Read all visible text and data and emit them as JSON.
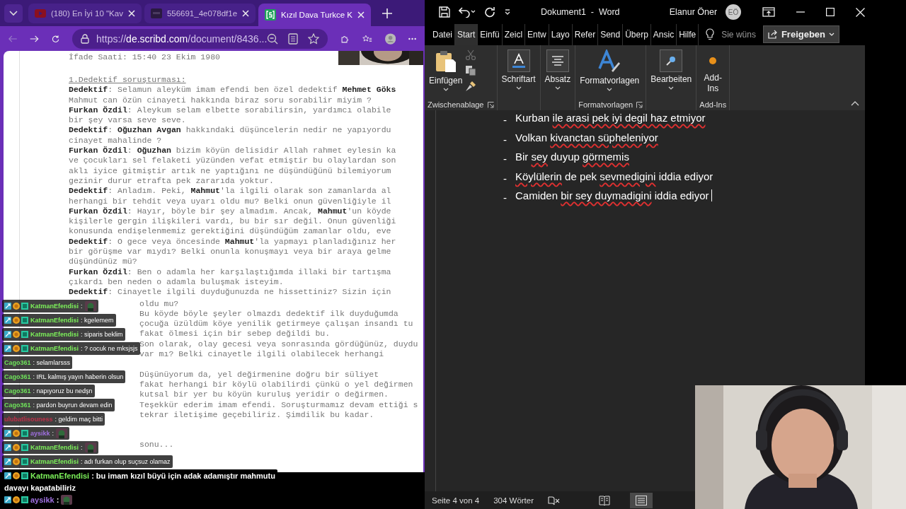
{
  "browser": {
    "tabs": [
      {
        "title": "(180) En İyi 10 \"Kav",
        "kind": "video",
        "selected": false
      },
      {
        "title": "556691_4e078df1e",
        "kind": "file",
        "selected": false
      },
      {
        "title": "Kızıl Dava Turkce K",
        "kind": "document",
        "selected": true
      }
    ],
    "url_scheme": "https://",
    "url_host": "de.scribd.com",
    "url_path": "/document/8436...",
    "document": {
      "header": "İfade Saati: 15:40 23 Ekim 1980",
      "heading": "1.Dedektif soruşturması:",
      "lines": [
        "**Dedektif**: Selamun aleyküm imam efendi ben özel dedektif **Mehmet Göks**",
        "Mahmut can özün cinayeti hakkında biraz soru sorabilir miyim ?",
        "**Furkan Özdil**: Aleykum selam elbette sorabilirsin, yardımcı olabile",
        "bir şey varsa seve seve.",
        "**Dedektif**: **Oğuzhan Avgan** hakkındaki düşüncelerin nedir ne yapıyordu",
        "cinayet mahalinde ?",
        "**Furkan Özdil**: **Oğuzhan** bizim köyün delisidir Allah rahmet eylesin ka",
        "ve çocukları sel felaketi yüzünden vefat etmiştir bu olaylardan son",
        "aklı iyice gitmiştir artık ne yaptığını ne düşündüğünü bilemiyorum",
        "gezinir durur etrafta pek zararıda yoktur.",
        "**Dedektif**: Anladım. Peki, **Mahmut**'la ilgili olarak son zamanlarda al",
        "herhangi bir tehdit veya uyarı oldu mu? Belki onun güvenliğiyle il",
        "**Furkan Özdil**: Hayır, böyle bir şey almadım. Ancak, **Mahmut**'un köyde",
        "kişilerle gergin ilişkileri vardı, bu bir sır değil. Onun güvenliği",
        "konusunda endişelenmemiz gerektiğini düşündüğüm zamanlar oldu, eve",
        "**Dedektif**: O gece veya öncesinde **Mahmut**'la yapmayı planladığınız her",
        "bir görüşme var mıydı? Belki onunla konuşmayı veya bir araya gelme",
        "düşündünüz mü?",
        "**Furkan Özdil**: Ben o adamla her karşılaştığımda illaki bir tartışma",
        "çıkardı ben neden o adamla buluşmak isteyim.",
        "**Dedektif**: Cinayetle ilgili duyduğunuzda ne hissettiniz? Sizin için"
      ],
      "fragments": [
        {
          "text": "oldu mu?",
          "kind": "line"
        },
        {
          "text": "Bu köyde böyle şeyler olmazdı dedektif ilk duyduğumda",
          "kind": "line"
        },
        {
          "text": "çocuğa üzüldüm köye yenilik getirmeye çalışan insandı tu",
          "kind": "line"
        },
        {
          "text": "fakat ölmesi için bir sebep değildi bu.",
          "kind": "line"
        },
        {
          "text": "Son olarak, olay gecesi veya sonrasında gördüğünüz, duydu",
          "kind": "line"
        },
        {
          "text": "var mı? Belki cinayetle ilgili olabilecek herhangi",
          "kind": "line"
        },
        {
          "text": "Düşünüyorum da, yel değirmenine doğru bir süliyet",
          "kind": "after-gap"
        },
        {
          "text": "fakat herhangi bir köylü olabilirdi çünkü o yel değirmen",
          "kind": "line"
        },
        {
          "text": "kutsal bir yer bu köyün kuruluş yeridir o değirmen.",
          "kind": "line"
        },
        {
          "text": "Teşekkür ederim imam efendi. Soruşturmamız devam ettiği s",
          "kind": "line"
        },
        {
          "text": "tekrar iletişime geçebiliriz. Şimdilik bu kadar.",
          "kind": "line"
        },
        {
          "text": "sonu...",
          "kind": "section-end"
        }
      ]
    }
  },
  "chat": [
    {
      "user": "KatmanEfendisi",
      "color": "#7cf05a",
      "badges": true,
      "message": ":",
      "kind": "emote"
    },
    {
      "user": "KatmanEfendisi",
      "color": "#7cf05a",
      "badges": true,
      "message": ": kgelemem",
      "kind": "text"
    },
    {
      "user": "KatmanEfendisi",
      "color": "#7cf05a",
      "badges": true,
      "message": ": siparis beklim",
      "kind": "text"
    },
    {
      "user": "KatmanEfendisi",
      "color": "#7cf05a",
      "badges": true,
      "message": ": ? cocuk ne mksjsjs",
      "kind": "text"
    },
    {
      "user": "Cago361",
      "color": "#6ee05a",
      "badges": false,
      "message": ": selamlarsss",
      "kind": "text"
    },
    {
      "user": "Cago361",
      "color": "#6ee05a",
      "badges": false,
      "message": ": IRL kalmış yayın haberin olsun",
      "kind": "text"
    },
    {
      "user": "Cago361",
      "color": "#6ee05a",
      "badges": false,
      "message": ": napıyoruz bu nedşn",
      "kind": "text"
    },
    {
      "user": "Cago361",
      "color": "#6ee05a",
      "badges": false,
      "message": ": pardon buyrun devam edin",
      "kind": "text"
    },
    {
      "user": "ulubatlisouness",
      "color": "#c0304a",
      "badges": false,
      "message": ": geldim maç bitti",
      "kind": "text"
    },
    {
      "user": "aysikk",
      "color": "#a070e0",
      "badges": true,
      "message": ":",
      "kind": "emote"
    },
    {
      "user": "KatmanEfendisi",
      "color": "#7cf05a",
      "badges": true,
      "message": ":",
      "kind": "emote"
    },
    {
      "user": "KatmanEfendisi",
      "color": "#7cf05a",
      "badges": true,
      "message": ": adı furkan olup suçsuz olamaz",
      "kind": "text"
    },
    {
      "user": "KatmanEfendisi",
      "color": "#7cf05a",
      "badges": true,
      "message": ": bu imam kızıl büyü için adak adamıştır mahmutu",
      "kind": "text"
    },
    {
      "message": "davayı kapatabiliriz",
      "kind": "continuation"
    },
    {
      "user": "aysikk",
      "color": "#a070e0",
      "badges": true,
      "message": ":",
      "kind": "emote"
    }
  ],
  "word": {
    "title": "Dokument1  -  Word",
    "user": "Elanur Öner",
    "initials": "EÖ",
    "tabs": [
      {
        "label": "Datei",
        "selected": false
      },
      {
        "label": "Start",
        "selected": true
      },
      {
        "label": "Einfü",
        "selected": false
      },
      {
        "label": "Zeicl",
        "selected": false
      },
      {
        "label": "Entw",
        "selected": false
      },
      {
        "label": "Layo",
        "selected": false
      },
      {
        "label": "Refer",
        "selected": false
      },
      {
        "label": "Send",
        "selected": false
      },
      {
        "label": "Überp",
        "selected": false
      },
      {
        "label": "Ansic",
        "selected": false
      },
      {
        "label": "Hilfe",
        "selected": false
      }
    ],
    "search_placeholder": "Sie wüns",
    "share": "Freigeben",
    "groups": [
      {
        "kind": "clipboard",
        "button": "Einfügen",
        "label": "Zwischenablage",
        "cut_disabled": true
      },
      {
        "kind": "font",
        "button": "Schriftart"
      },
      {
        "kind": "paragraph",
        "button": "Absatz"
      },
      {
        "kind": "styles",
        "button": "Formatvorlagen",
        "label": "Formatvorlagen"
      },
      {
        "kind": "editing",
        "button": "Bearbeiten"
      },
      {
        "kind": "addins",
        "button": "Add-Ins",
        "label": "Add-Ins"
      }
    ],
    "lines": [
      {
        "segments": [
          {
            "text": "Kurban ",
            "misspelled": false
          },
          {
            "text": "ile arasi pek iyi degil haz etmiyor",
            "misspelled": true
          }
        ]
      },
      {
        "segments": [
          {
            "text": "Volkan ",
            "misspelled": false
          },
          {
            "text": "kivanctan süpheleniyor",
            "misspelled": true
          }
        ]
      },
      {
        "segments": [
          {
            "text": "Bir ",
            "misspelled": false
          },
          {
            "text": "sey",
            "misspelled": true
          },
          {
            "text": " duyup ",
            "misspelled": false
          },
          {
            "text": "görmemis",
            "misspelled": true
          }
        ]
      },
      {
        "segments": [
          {
            "text": "Köylülerin",
            "misspelled": true
          },
          {
            "text": " de pek ",
            "misspelled": false
          },
          {
            "text": "sevmedigini",
            "misspelled": true
          },
          {
            "text": " iddia ediyor",
            "misspelled": false
          }
        ]
      },
      {
        "segments": [
          {
            "text": "Camiden ",
            "misspelled": false
          },
          {
            "text": "bir sey duymadigini",
            "misspelled": true
          },
          {
            "text": " iddia ediyor",
            "misspelled": false
          }
        ]
      }
    ],
    "bullet": "-",
    "status": {
      "page": "Seite 4 von 4",
      "words": "304 Wörter"
    },
    "views": [
      {
        "kind": "read",
        "selected": false
      },
      {
        "kind": "print",
        "selected": true
      }
    ]
  }
}
